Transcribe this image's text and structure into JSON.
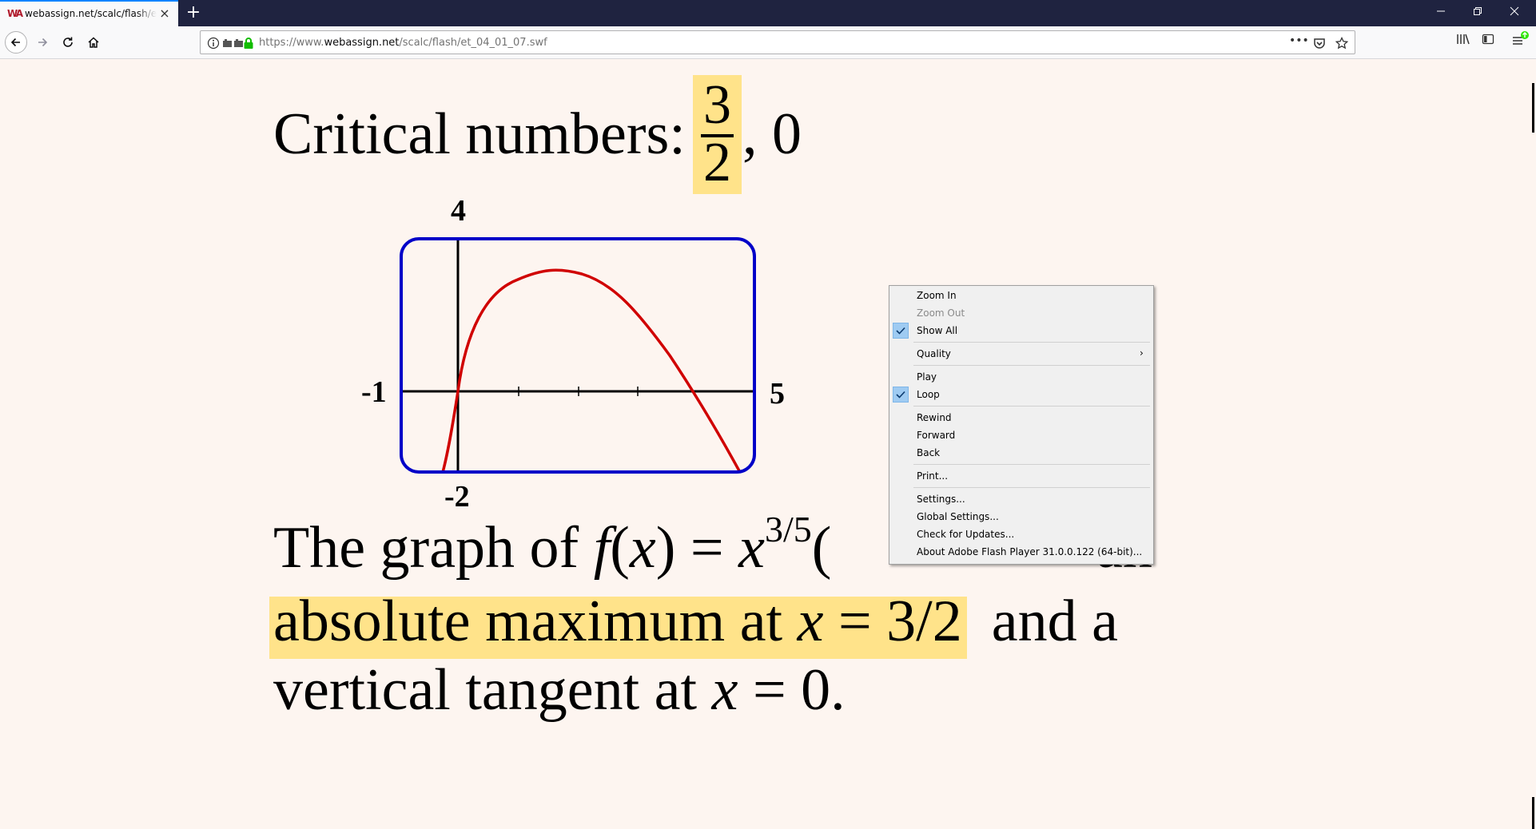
{
  "browser": {
    "tab_title": "webassign.net/scalc/flash/et_04_01_07.swf",
    "tab_close": "×",
    "new_tab": "+",
    "url_prefix": "https://www.",
    "url_domain": "webassign.net",
    "url_path": "/scalc/flash/et_04_01_07.swf",
    "page_actions": "•••"
  },
  "slide": {
    "critical_label": "Critical numbers:",
    "frac_num": "3",
    "frac_den": "2",
    "critical_rest": ", 0",
    "graph": {
      "label_top": "4",
      "label_left": "-1",
      "label_right": "5",
      "label_bottom": "-2"
    },
    "line1_a": "The graph of ",
    "line1_f": "f",
    "line1_b": "(",
    "line1_x": "x",
    "line1_c": ") = ",
    "line1_x2": "x",
    "line1_exp": "3/5",
    "line1_d": "(",
    "line1_end": "an",
    "line2_a": "absolute maximum at ",
    "line2_x": "x",
    "line2_b": " = 3/2",
    "line2_c": "  and a",
    "line3_a": "vertical tangent at ",
    "line3_x": "x",
    "line3_b": " = 0."
  },
  "context_menu": {
    "zoom_in": "Zoom In",
    "zoom_out": "Zoom Out",
    "show_all": "Show All",
    "quality": "Quality",
    "play": "Play",
    "loop": "Loop",
    "rewind": "Rewind",
    "forward": "Forward",
    "back": "Back",
    "print": "Print...",
    "settings": "Settings...",
    "global_settings": "Global Settings...",
    "check_updates": "Check for Updates...",
    "about": "About Adobe Flash Player 31.0.0.122 (64-bit)..."
  },
  "colors": {
    "highlight": "#ffe38a",
    "graph_frame": "#0000c8",
    "curve": "#d00000",
    "page_bg": "#fdf5f0"
  }
}
